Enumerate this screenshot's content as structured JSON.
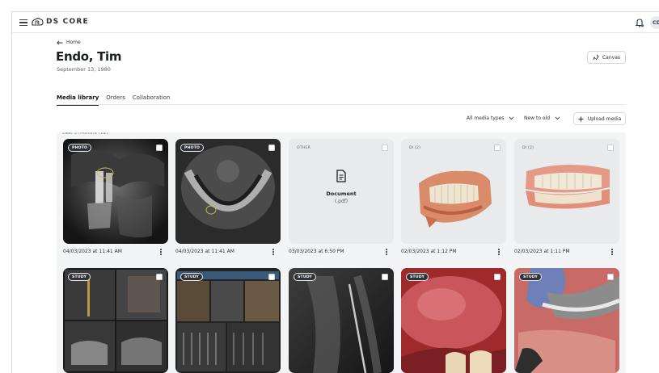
{
  "app": {
    "brand": "DS CORE",
    "avatar_initials": "CD"
  },
  "header": {
    "back_label": "Home",
    "patient_name": "Endo, Tim",
    "dob": "September 13, 1980",
    "canvas_label": "Canvas"
  },
  "tabs": [
    {
      "label": "Media library",
      "active": true
    },
    {
      "label": "Orders",
      "active": false
    },
    {
      "label": "Collaboration",
      "active": false
    }
  ],
  "toolbar": {
    "media_type_filter": "All media types",
    "sort_order": "New to old",
    "upload_label": "Upload media"
  },
  "gallery": {
    "section_label": "Last 3 months (12)",
    "row1": [
      {
        "tag": "PHOTO",
        "date": "04/03/2023 at 11:41 AM",
        "kind": "xray-panoramic-detail"
      },
      {
        "tag": "PHOTO",
        "date": "04/03/2023 at 11:41 AM",
        "kind": "xray-axial"
      },
      {
        "tag": "OTHER",
        "date": "03/03/2023 at 6:50 PM",
        "kind": "document",
        "doc_title": "Document",
        "doc_ext": "(.pdf)"
      },
      {
        "tag": "DI (2)",
        "date": "02/03/2023 at 1:12 PM",
        "kind": "scan-3d-model"
      },
      {
        "tag": "DI (2)",
        "date": "02/03/2023 at 1:11 PM",
        "kind": "scan-3d-model"
      }
    ],
    "row2": [
      {
        "tag": "STUDY",
        "kind": "cbct-views"
      },
      {
        "tag": "STUDY",
        "kind": "cbct-slices"
      },
      {
        "tag": "STUDY",
        "kind": "periapical-xray"
      },
      {
        "tag": "STUDY",
        "kind": "intraoral-photo"
      },
      {
        "tag": "STUDY",
        "kind": "intraoral-photo-gloved"
      }
    ]
  },
  "icons": {
    "menu": "hamburger-icon",
    "logo": "ds-core-logo",
    "notifications": "bell-icon",
    "back": "arrow-left-icon",
    "canvas": "canvas-icon",
    "chevron": "chevron-down-icon",
    "upload": "plus-icon",
    "document": "document-icon",
    "more": "more-vertical-icon"
  },
  "colors": {
    "accent_text": "#1c1f23",
    "gallery_bg": "#f3f4f6",
    "tag_dark_bg": "#2f3236"
  }
}
